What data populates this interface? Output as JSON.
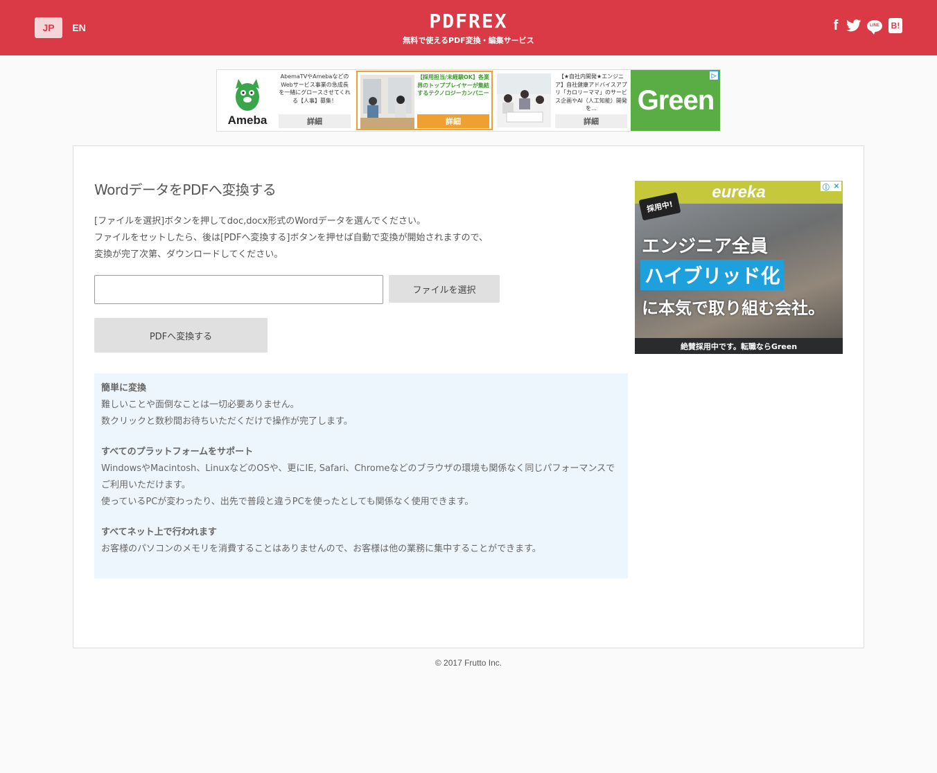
{
  "header": {
    "lang_jp": "JP",
    "lang_en": "EN",
    "logo": "PDFREX",
    "tagline": "無料で使えるPDF変換・編集サービス",
    "social": {
      "facebook": "f",
      "line": "LINE",
      "hatena": "B!"
    },
    "bg_color": "#d93a45"
  },
  "top_ad": {
    "units": [
      {
        "text": "AbemaTVやAmebaなどのWebサービス事業の急成長を一緒にグロースさせてくれる【人事】募集！",
        "button": "詳細",
        "brand": "Ameba"
      },
      {
        "text": "【採用担当/未経験OK】各業界のトッププレイヤーが集結するテクノロジーカンパニー",
        "button": "詳細"
      },
      {
        "text": "【★自社内開発★エンジニア】自社健康アドバイスアプリ「カロリーママ」のサービス企画やAI（人工知能）開発を…",
        "button": "詳細"
      }
    ],
    "brand": "Green"
  },
  "main": {
    "title": "WordデータをPDFへ変換する",
    "desc": [
      "[ファイルを選択]ボタンを押してdoc,docx形式のWordデータを選んでください。",
      "ファイルをセットしたら、後は[PDFへ変換する]ボタンを押せば自動で変換が開始されますので、",
      "変換が完了次第、ダウンロードしてください。"
    ],
    "file_value": "",
    "choose_file_label": "ファイルを選択",
    "convert_label": "PDFへ変換する"
  },
  "features": [
    {
      "heading": "簡単に変換",
      "lines": [
        "難しいことや面倒なことは一切必要ありません。",
        "数クリックと数秒間お待ちいただくだけで操作が完了します。"
      ]
    },
    {
      "heading": "すべてのプラットフォームをサポート",
      "lines": [
        "WindowsやMacintosh、LinuxなどのOSや、更にIE,  Safari、Chromeなどのブラウザの環境も関係なく同じパフォーマンスでご利用いただけます。",
        "使っているPCが変わったり、出先で普段と違うPCを使ったとしても関係なく使用できます。"
      ]
    },
    {
      "heading": "すべてネット上で行われます",
      "lines": [
        "お客様のパソコンのメモリを消費することはありませんので、お客様は他の業務に集中することができます。"
      ]
    }
  ],
  "side_ad": {
    "brand": "eureka",
    "badge": "採用中!",
    "line1": "エンジニア全員",
    "line2": "ハイブリッド化",
    "line3": "に本気で取り組む会社。",
    "footer": "絶賛採用中です。転職ならGreen"
  },
  "footer": {
    "copyright": "© 2017 Frutto Inc."
  }
}
